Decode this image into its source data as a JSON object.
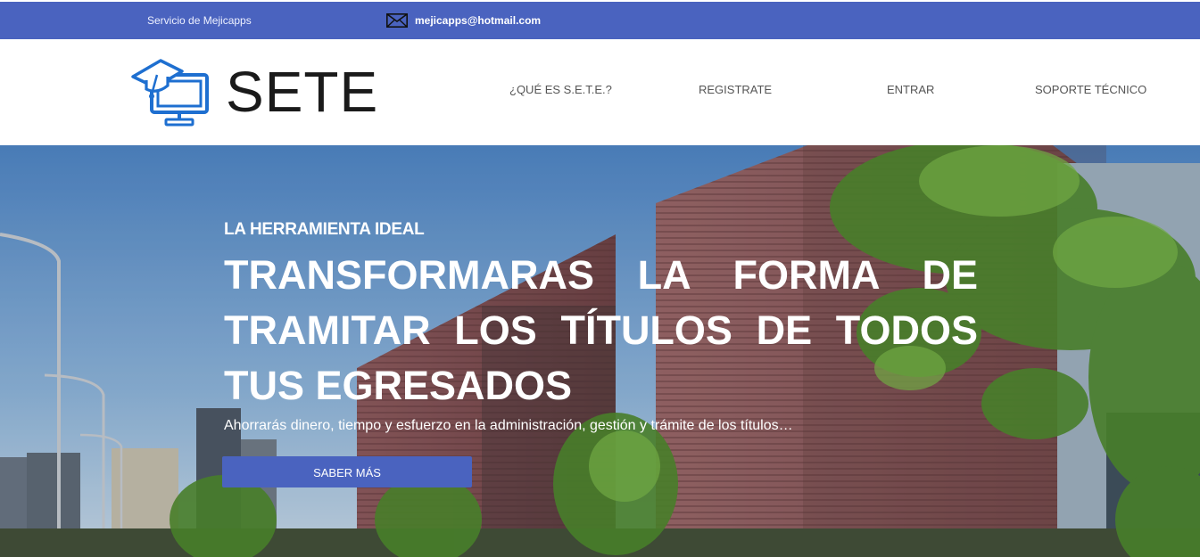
{
  "topbar": {
    "service_label": "Servicio de Mejicapps",
    "email_icon": "mail-icon",
    "email": "mejicapps@hotmail.com"
  },
  "header": {
    "logo_icon": "graduation-monitor-icon",
    "logo_text": "SETE",
    "nav": [
      {
        "label": "¿QUÉ ES S.E.T.E.?"
      },
      {
        "label": "REGISTRATE"
      },
      {
        "label": "ENTRAR"
      },
      {
        "label": "SOPORTE TÉCNICO"
      }
    ]
  },
  "hero": {
    "eyebrow": "LA HERRAMIENTA IDEAL",
    "title": "TRANSFORMARAS LA FORMA DE TRAMITAR LOS TÍTULOS DE TODOS TUS EGRESADOS",
    "subtitle": "Ahorrarás dinero, tiempo y esfuerzo en la administración, gestión y trámite de los títulos…",
    "button_label": "SABER MÁS"
  },
  "colors": {
    "brand_blue": "#4a63bf",
    "logo_blue": "#1e6fd0"
  }
}
